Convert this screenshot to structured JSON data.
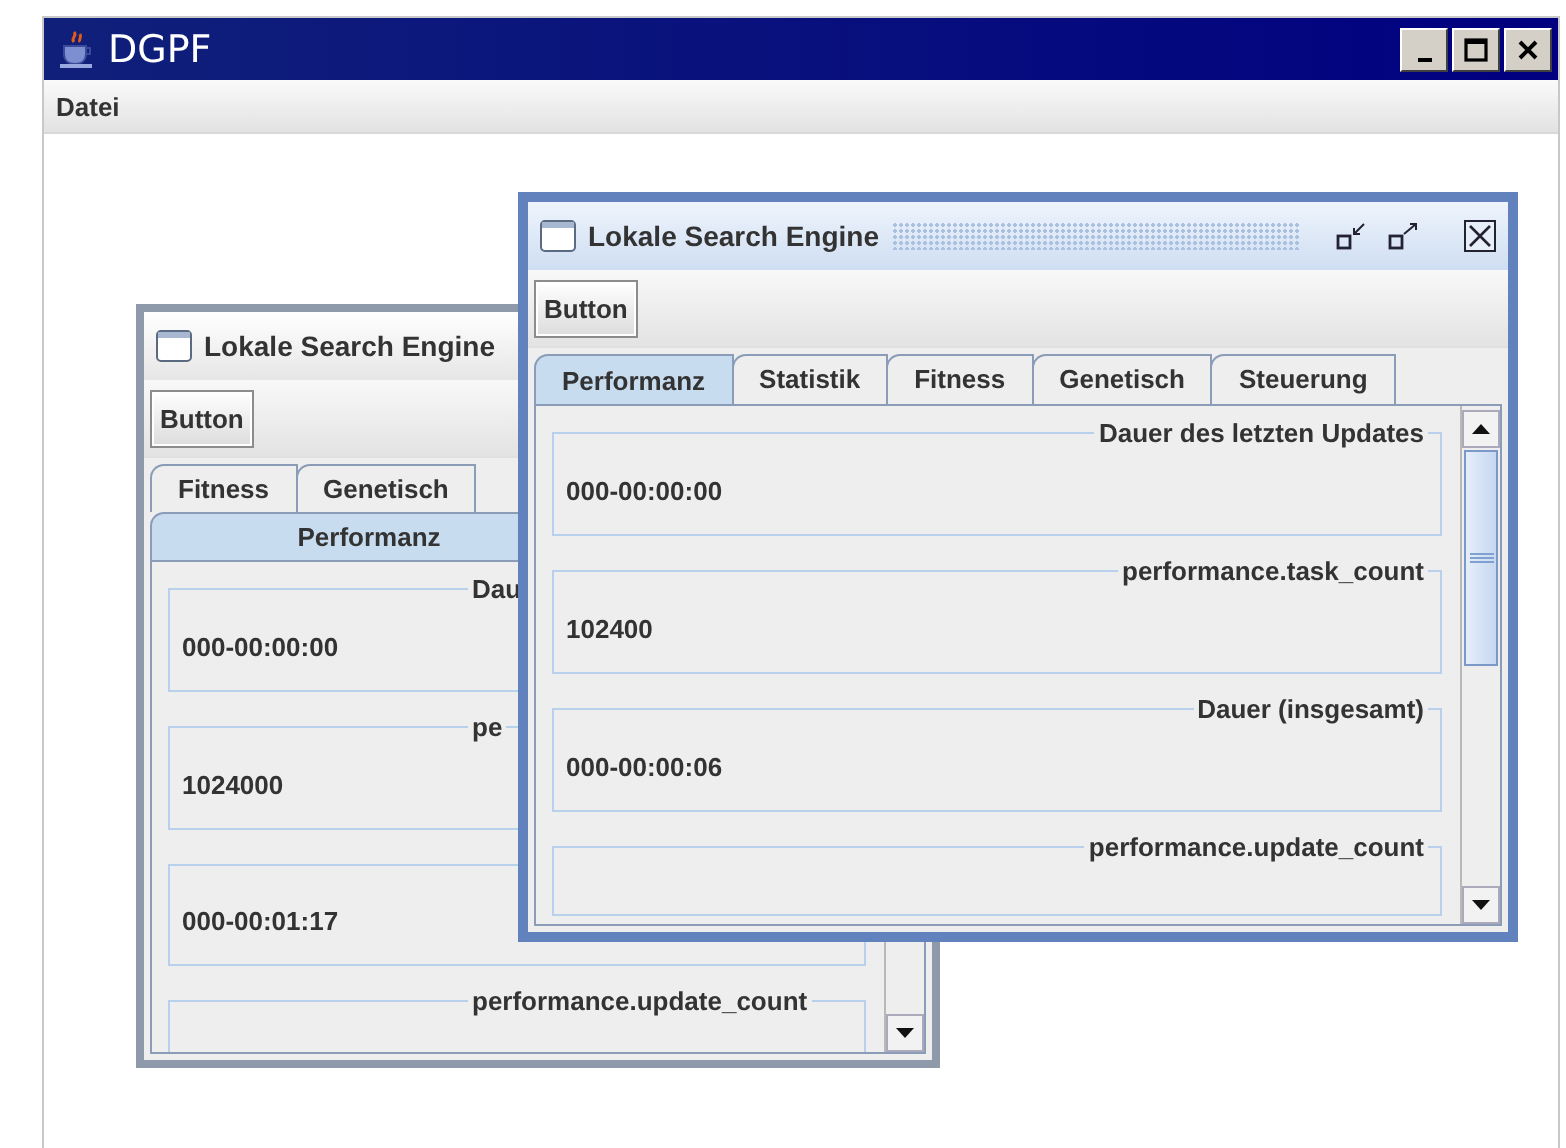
{
  "window": {
    "title": "DGPF"
  },
  "menu": [
    {
      "label": "Datei"
    }
  ],
  "internal_windows": [
    {
      "title": "Lokale Search Engine",
      "active": false,
      "button": "Button",
      "tab_rows": [
        [
          {
            "label": "Fitness",
            "selected": false
          },
          {
            "label": "Genetisch",
            "selected": false
          }
        ],
        [
          {
            "label": "Performanz",
            "selected": true
          }
        ]
      ],
      "fields": [
        {
          "label": "Dau",
          "value": "000-00:00:00"
        },
        {
          "label": "pe",
          "value": "1024000"
        },
        {
          "value": "000-00:01:17"
        },
        {
          "label": "performance.update_count"
        }
      ]
    },
    {
      "title": "Lokale Search Engine",
      "active": true,
      "button": "Button",
      "tab_rows": [
        [
          {
            "label": "Performanz",
            "selected": true
          },
          {
            "label": "Statistik",
            "selected": false
          },
          {
            "label": "Fitness",
            "selected": false
          },
          {
            "label": "Genetisch",
            "selected": false
          },
          {
            "label": "Steuerung",
            "selected": false
          }
        ]
      ],
      "fields": [
        {
          "label": "Dauer des letzten Updates",
          "value": "000-00:00:00"
        },
        {
          "label": "performance.task_count",
          "value": "102400"
        },
        {
          "label": "Dauer (insgesamt)",
          "value": "000-00:00:06"
        },
        {
          "label": "performance.update_count"
        }
      ]
    }
  ]
}
